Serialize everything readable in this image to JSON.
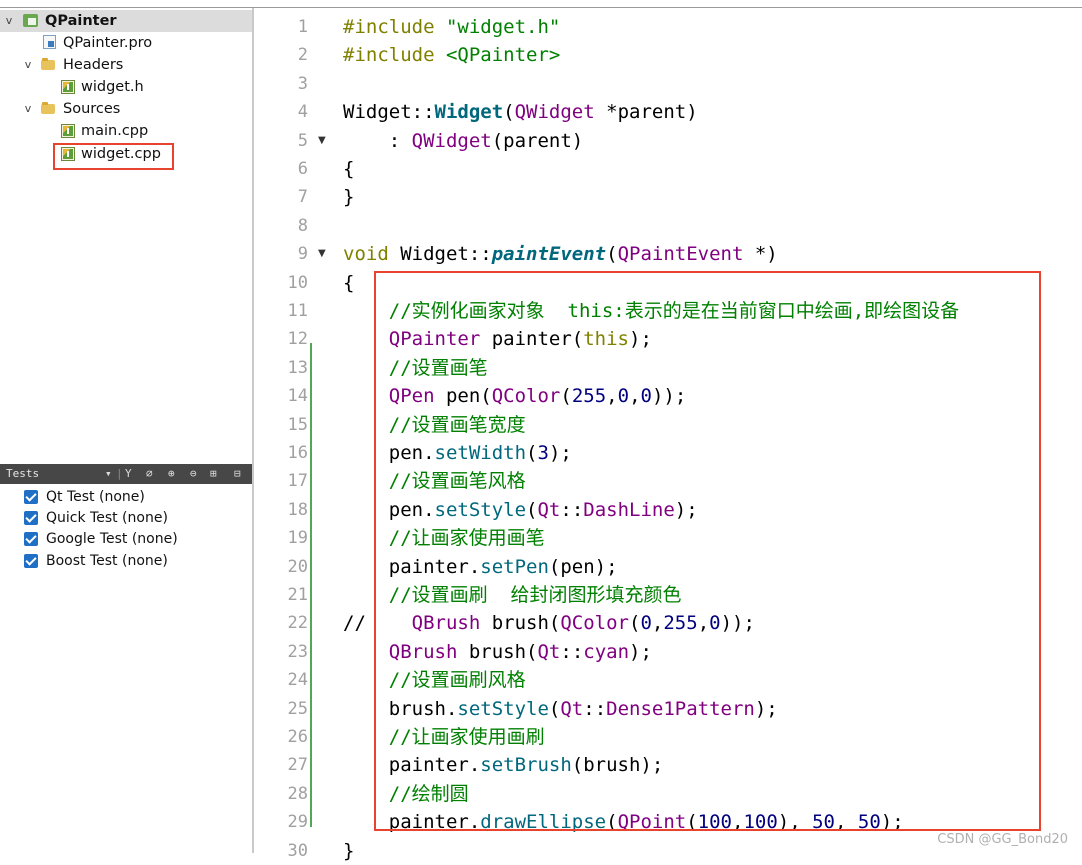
{
  "project_tree": {
    "project": "QPainter",
    "items": [
      {
        "label": "QPainter.pro"
      },
      {
        "label": "Headers",
        "children": [
          "widget.h"
        ]
      },
      {
        "label": "Sources",
        "children": [
          "main.cpp",
          "widget.cpp"
        ]
      }
    ]
  },
  "tests": {
    "header": "Tests",
    "toolbar_icons": [
      "filter-icon",
      "wand-icon",
      "expand-all-icon",
      "collapse-all-icon",
      "add-icon",
      "close-pane-icon"
    ],
    "items": [
      {
        "label": "Qt Test (none)",
        "checked": true
      },
      {
        "label": "Quick Test (none)",
        "checked": true
      },
      {
        "label": "Google Test (none)",
        "checked": true
      },
      {
        "label": "Boost Test (none)",
        "checked": true
      }
    ]
  },
  "editor": {
    "line_numbers": [
      "1",
      "2",
      "3",
      "4",
      "5",
      "6",
      "7",
      "8",
      "9",
      "10",
      "11",
      "12",
      "13",
      "14",
      "15",
      "16",
      "17",
      "18",
      "19",
      "20",
      "21",
      "22",
      "23",
      "24",
      "25",
      "26",
      "27",
      "28",
      "29",
      "30"
    ],
    "lines": [
      "#include \"widget.h\"",
      "#include <QPainter>",
      "",
      "Widget::Widget(QWidget *parent)",
      "    : QWidget(parent)",
      "{",
      "}",
      "",
      "void Widget::paintEvent(QPaintEvent *)",
      "{",
      "    //实例化画家对象  this:表示的是在当前窗口中绘画,即绘图设备",
      "    QPainter painter(this);",
      "    //设置画笔",
      "    QPen pen(QColor(255,0,0));",
      "    //设置画笔宽度",
      "    pen.setWidth(3);",
      "    //设置画笔风格",
      "    pen.setStyle(Qt::DashLine);",
      "    //让画家使用画笔",
      "    painter.setPen(pen);",
      "    //设置画刷  给封闭图形填充颜色",
      "//    QBrush brush(QColor(0,255,0));",
      "    QBrush brush(Qt::cyan);",
      "    //设置画刷风格",
      "    brush.setStyle(Qt::Dense1Pattern);",
      "    //让画家使用画刷",
      "    painter.setBrush(brush);",
      "    //绘制圆",
      "    painter.drawEllipse(QPoint(100,100), 50, 50);",
      "}"
    ],
    "fold_markers": [
      "5",
      "9"
    ]
  },
  "watermark": "CSDN @GG_Bond20",
  "colors": {
    "highlight_box": "#e8432e",
    "comment": "#008000",
    "type": "#800080",
    "function": "#00677c",
    "number": "#000080",
    "keyword": "#808000"
  }
}
